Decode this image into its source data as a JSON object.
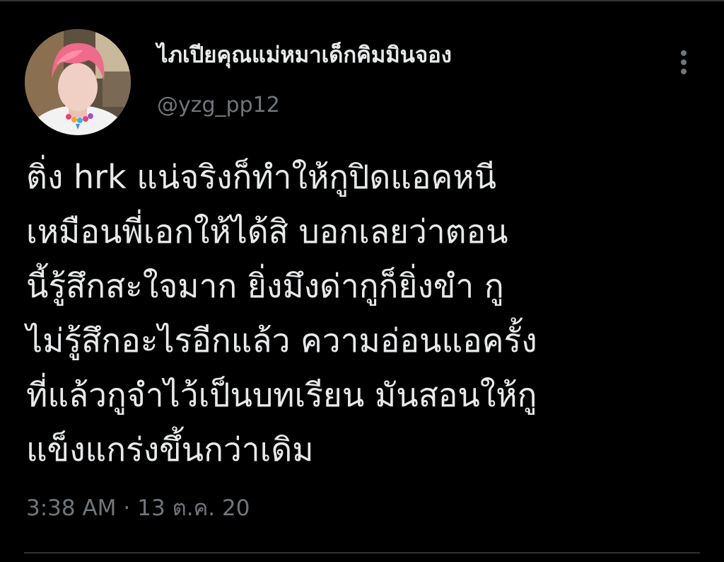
{
  "tweet": {
    "author": {
      "display_name": "ไภเปียคุณแม่หมาเด็กคิมมินจอง",
      "handle": "@yzg_pp12"
    },
    "text": "ติ่ง hrk แน่จริงก็ทำให้กูปิดแอคหนี\nเหมือนพี่เอกให้ได้สิ บอกเลยว่าตอน\nนี้รู้สึกสะใจมาก ยิ่งมึงด่ากูก็ยิ่งขำ กู\nไม่รู้สึกอะไรอีกแล้ว ความอ่อนแอครั้ง\nที่แล้วกูจำไว้เป็นบทเรียน มันสอนให้กู\nแข็งแกร่งขึ้นกว่าเดิม",
    "time": "3:38 AM",
    "separator": "·",
    "date": "13 ต.ค. 20"
  },
  "icons": {
    "more": "more-vertical-icon"
  },
  "colors": {
    "background": "#000000",
    "primary_text": "#e7e9ea",
    "secondary_text": "#71767b",
    "divider": "#2f3336"
  }
}
